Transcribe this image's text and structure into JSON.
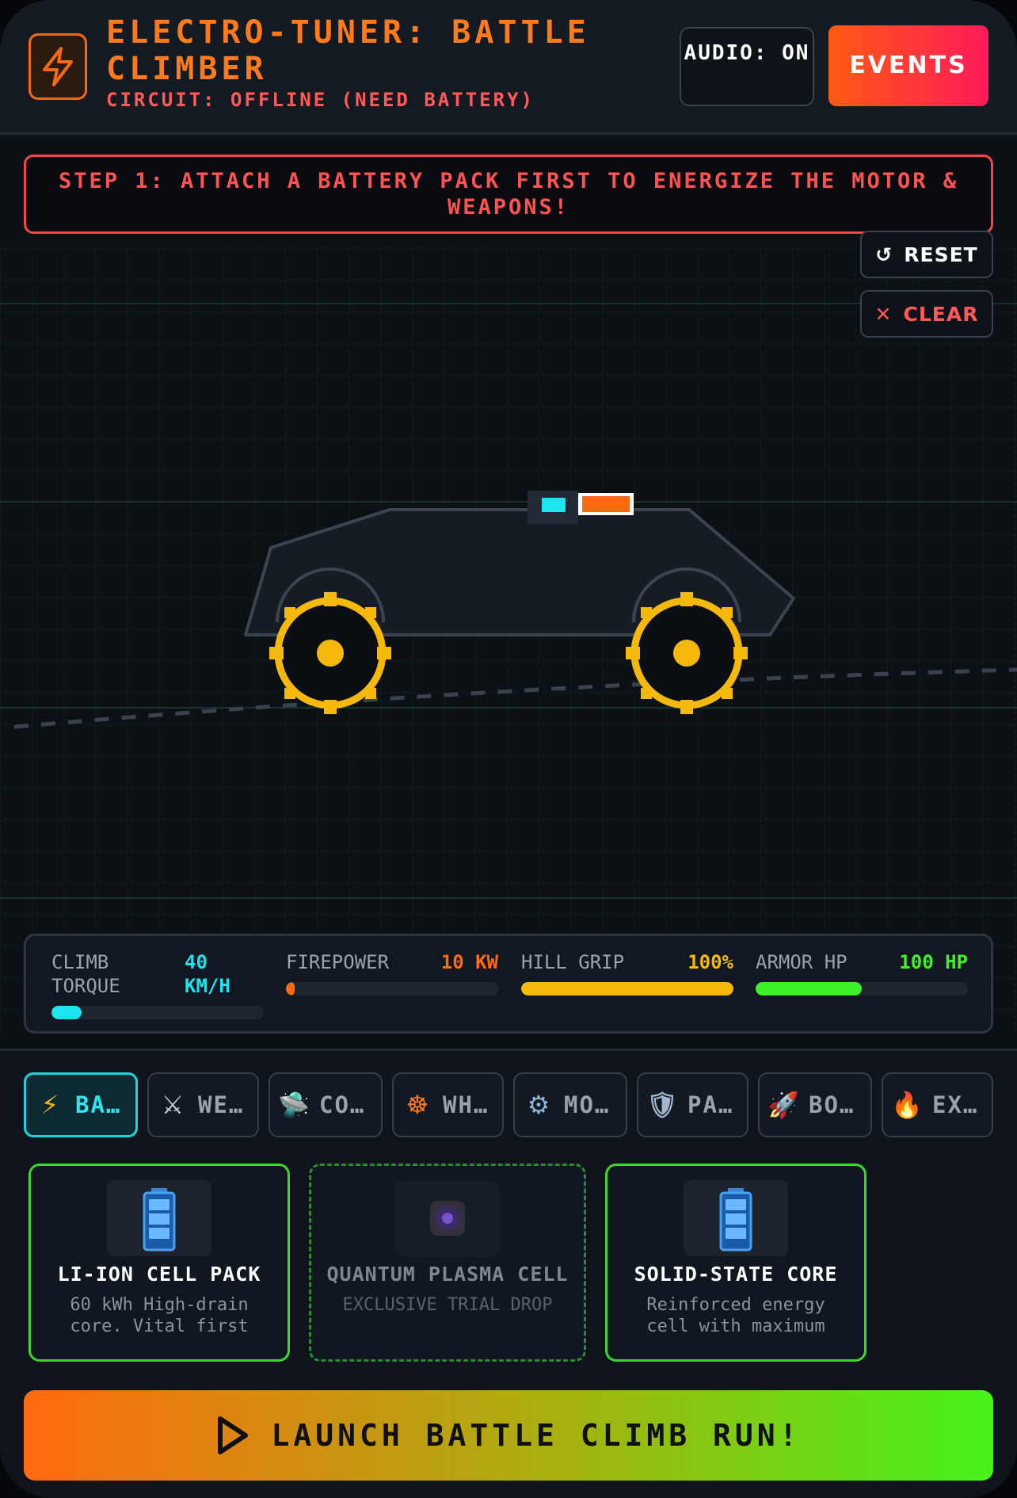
{
  "header": {
    "title": "ELECTRO-TUNER: BATTLE CLIMBER",
    "status": "CIRCUIT: OFFLINE (NEED BATTERY)",
    "audio_label": "AUDIO: ON",
    "events_label": "EVENTS",
    "logo_icon": "lightning-bolt-icon"
  },
  "stage": {
    "banner": "STEP 1: ATTACH A BATTERY PACK FIRST TO ENERGIZE THE MOTOR & WEAPONS!",
    "reset_label": "RESET",
    "reset_icon": "↺",
    "clear_label": "CLEAR",
    "clear_icon": "✕"
  },
  "stats": [
    {
      "label": "CLIMB TORQUE",
      "value": "40 KM/H",
      "color": "#1ee3f0",
      "fill": 0.14
    },
    {
      "label": "FIREPOWER",
      "value": "10 KW",
      "color": "#ff6a10",
      "fill": 0.04
    },
    {
      "label": "HILL GRIP",
      "value": "100%",
      "color": "#f5b80d",
      "fill": 1.0
    },
    {
      "label": "ARMOR HP",
      "value": "100 HP",
      "color": "#3ef02a",
      "fill": 0.5
    }
  ],
  "tabs": [
    {
      "icon": "⚡",
      "label": "BA…",
      "active": true
    },
    {
      "icon": "⚔",
      "label": "WE…"
    },
    {
      "icon": "🛸",
      "label": "CO…"
    },
    {
      "icon": "☸",
      "label": "WH…"
    },
    {
      "icon": "⚙",
      "label": "MO…"
    },
    {
      "icon": "🛡",
      "label": "PA…"
    },
    {
      "icon": "🚀",
      "label": "BO…"
    },
    {
      "icon": "🔥",
      "label": "EX…"
    }
  ],
  "cards": [
    {
      "title": "LI-ION CELL PACK",
      "desc": "60 kWh High-drain core. Vital first",
      "icon": "battery-icon"
    },
    {
      "title": "QUANTUM PLASMA CELL",
      "desc": "EXCLUSIVE TRIAL DROP",
      "icon": "plasma-cell-icon"
    },
    {
      "title": "SOLID-STATE CORE",
      "desc": "Reinforced energy cell with maximum",
      "icon": "battery-icon"
    }
  ],
  "launch_label": "LAUNCH BATTLE CLIMB RUN!",
  "colors": {
    "accent": "#ff7a1a",
    "danger": "#ff5252",
    "cyan": "#18d6e0",
    "green": "#3ad82e",
    "wheel": "#f5b80d"
  }
}
